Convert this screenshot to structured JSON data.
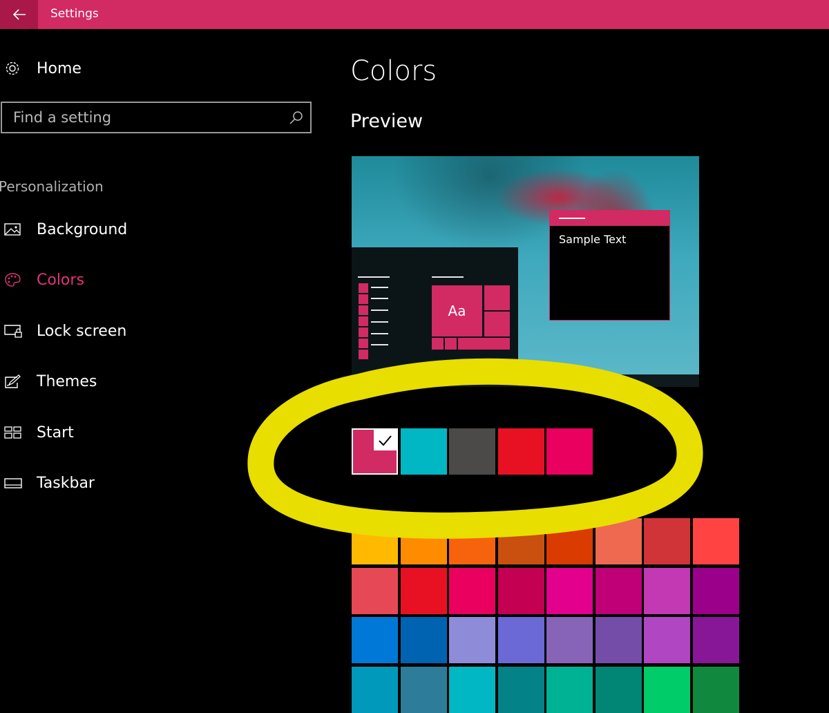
{
  "window": {
    "title": "Settings"
  },
  "sidebar": {
    "home_label": "Home",
    "search": {
      "placeholder": "Find a setting"
    },
    "section_label": "Personalization",
    "items": [
      {
        "label": "Background",
        "icon": "picture-icon",
        "active": false
      },
      {
        "label": "Colors",
        "icon": "palette-icon",
        "active": true
      },
      {
        "label": "Lock screen",
        "icon": "lock-screen-icon",
        "active": false
      },
      {
        "label": "Themes",
        "icon": "themes-icon",
        "active": false
      },
      {
        "label": "Start",
        "icon": "start-icon",
        "active": false
      },
      {
        "label": "Taskbar",
        "icon": "taskbar-icon",
        "active": false
      }
    ]
  },
  "main": {
    "title": "Colors",
    "preview_heading": "Preview",
    "preview": {
      "sample_text": "Sample Text",
      "tile_text": "Aa"
    }
  },
  "recent_colors": {
    "selected_index": 0,
    "colors": [
      "#d22a63",
      "#00b7c3",
      "#4c4a48",
      "#e81123",
      "#ea005e"
    ]
  },
  "windows_colors": [
    [
      "#ffb900",
      "#ff8c00",
      "#f7630c",
      "#ca5010",
      "#da3b01",
      "#ef6950",
      "#d13438",
      "#ff4343"
    ],
    [
      "#e74856",
      "#e81123",
      "#ea005e",
      "#c30052",
      "#e3008c",
      "#bf0077",
      "#c239b3",
      "#9a0089"
    ],
    [
      "#0078d7",
      "#0063b1",
      "#8e8cd8",
      "#6b69d6",
      "#8764b8",
      "#744da9",
      "#b146c2",
      "#881798"
    ],
    [
      "#0099bc",
      "#2d7d9a",
      "#00b7c3",
      "#038387",
      "#00b294",
      "#018574",
      "#00cc6a",
      "#10893e"
    ]
  ],
  "colors": {
    "accent": "#d22a63",
    "title_bar_back": "#a8194a",
    "highlight_annotation": "#e8de00"
  }
}
